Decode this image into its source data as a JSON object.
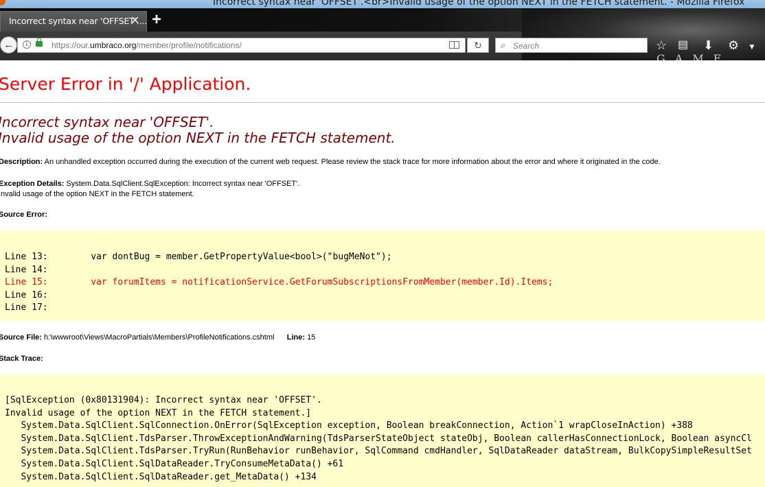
{
  "window": {
    "title": "Incorrect syntax near 'OFFSET'.<br>Invalid usage of the option NEXT in the FETCH statement. - Mozilla Firefox"
  },
  "tab": {
    "title": "Incorrect syntax near 'OFFSET'....",
    "close_glyph": "✕",
    "new_tab_glyph": "+"
  },
  "toolbar": {
    "url_prefix": "https://our.",
    "url_domain": "umbraco.org",
    "url_path": "/member/profile/notifications/",
    "search_placeholder": "Search",
    "icons": [
      "back-icon",
      "info-icon",
      "lock-icon",
      "reader-view-icon",
      "reload-icon",
      "search-icon",
      "bookmark-star-icon",
      "reading-list-icon",
      "download-icon",
      "settings-icon"
    ],
    "theme_logo_text": "GAME OF"
  },
  "page": {
    "heading": "Server Error in '/' Application.",
    "error_line1": "Incorrect syntax near 'OFFSET'.",
    "error_line2": "Invalid usage of the option NEXT in the FETCH statement.",
    "description_label": "Description:",
    "description_text": " An unhandled exception occurred during the execution of the current web request. Please review the stack trace for more information about the error and where it originated in the code.",
    "exception_label": "Exception Details:",
    "exception_text1": " System.Data.SqlClient.SqlException: Incorrect syntax near 'OFFSET'.",
    "exception_text2": "Invalid usage of the option NEXT in the FETCH statement.",
    "source_error_label": "Source Error:",
    "source_lines": [
      {
        "num": "Line 13:",
        "code": "    var dontBug = member.GetPropertyValue<bool>(\"bugMeNot\");"
      },
      {
        "num": "Line 14:",
        "code": ""
      },
      {
        "num": "Line 15:",
        "code": "    var forumItems = notificationService.GetForumSubscriptionsFromMember(member.Id).Items;"
      },
      {
        "num": "Line 16:",
        "code": ""
      },
      {
        "num": "Line 17:",
        "code": ""
      }
    ],
    "source_file_label": "Source File:",
    "source_file_path": " h:\\wwwroot\\Views\\MacroPartials\\Members\\ProfileNotifications.cshtml",
    "line_label": "Line:",
    "line_value": " 15",
    "stack_trace_label": "Stack Trace:",
    "stack_lines": [
      "[SqlException (0x80131904): Incorrect syntax near 'OFFSET'.",
      "Invalid usage of the option NEXT in the FETCH statement.]",
      "   System.Data.SqlClient.SqlConnection.OnError(SqlException exception, Boolean breakConnection, Action`1 wrapCloseInAction) +388",
      "   System.Data.SqlClient.TdsParser.ThrowExceptionAndWarning(TdsParserStateObject stateObj, Boolean callerHasConnectionLock, Boolean asyncCl",
      "   System.Data.SqlClient.TdsParser.TryRun(RunBehavior runBehavior, SqlCommand cmdHandler, SqlDataReader dataStream, BulkCopySimpleResultSet",
      "   System.Data.SqlClient.SqlDataReader.TryConsumeMetaData() +61",
      "   System.Data.SqlClient.SqlDataReader.get_MetaData() +134"
    ]
  }
}
